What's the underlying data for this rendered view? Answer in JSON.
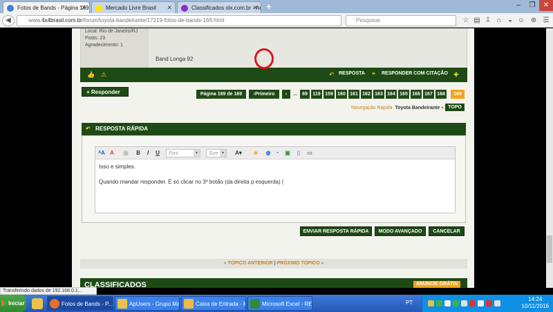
{
  "browser": {
    "tabs": [
      {
        "label": "Fotos de Bands - Página 169",
        "active": true
      },
      {
        "label": "Mercado Livre Brasil",
        "active": false
      },
      {
        "label": "Classificados olx.com.br - An...",
        "active": false
      }
    ],
    "new_tab": "+",
    "url_prefix": "www.",
    "url_domain": "4x4brasil.com.br",
    "url_path": "/forum/toyota-bandeirante/17219-fotos-de-bands-169.html",
    "search_placeholder": "Pesquisar"
  },
  "post": {
    "location": "Local: Rio de Janeiro/RJ",
    "posts": "Posts: 23",
    "thanks": "Agradecimento: 1",
    "message": "Band Longa 92",
    "actions": {
      "reply": "RESPOSTA",
      "quote": "RESPONDER COM CITAÇÃO"
    }
  },
  "responder_label": "+ Responder",
  "pagination": {
    "summary": "Página 169 de 169",
    "first": "‹Primeiro",
    "prev": "‹",
    "ellipsis": "...",
    "pages": [
      "69",
      "119",
      "159",
      "160",
      "161",
      "162",
      "163",
      "164",
      "165",
      "166",
      "167",
      "168"
    ],
    "current": "169"
  },
  "quick_nav": {
    "label": "Navegação Rápida",
    "section": "Toyota Bandeirante",
    "top": "TOPO"
  },
  "quick_reply": {
    "title": "RESPOSTA RÁPIDA",
    "font_placeholder": "Font",
    "size_placeholder": "Size",
    "line1": "Isso e simples.",
    "line2": "Quando mandar responder. É só clicar no 3º botão (da direita p esquerda) |"
  },
  "buttons": {
    "send": "ENVIAR RESPOSTA RÁPIDA",
    "advanced": "MODO AVANÇADO",
    "cancel": "CANCELAR"
  },
  "thread_nav": {
    "prev": "« TÓPICO ANTERIOR",
    "sep": "|",
    "next": "PRÓXIMO TÓPICO »"
  },
  "classifieds": {
    "title": "CLASSIFICADOS",
    "advertise": "ANUNCIE GRÁTIS"
  },
  "status_text": "Transferindo dados de 192.168.0.1...",
  "taskbar": {
    "start": "Iniciar",
    "tasks": [
      {
        "label": "Fotos de Bands - P...",
        "active": true
      },
      {
        "label": "ApUsers - Grupo Mag...",
        "active": false
      },
      {
        "label": "Caixa de Entrada - Mi...",
        "active": false
      },
      {
        "label": "Microsoft Excel - REV...",
        "active": false
      }
    ],
    "lang": "PT",
    "time": "14:24",
    "date": "10/11/2016"
  },
  "colors": {
    "brand_green": "#1e4a15",
    "accent_orange": "#f0a51b",
    "highlight_red": "#e0141c"
  }
}
